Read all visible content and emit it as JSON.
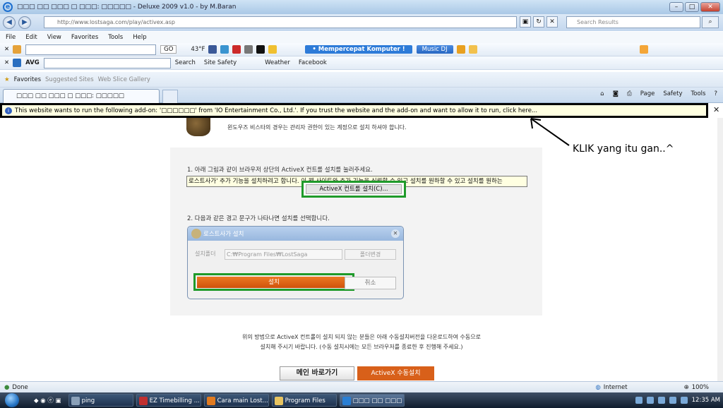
{
  "window": {
    "title": "□□□ □□ □□□ □ □□□: □□□□□ - Deluxe 2009 v1.0 - by M.Baran"
  },
  "address": {
    "url": "http://www.lostsaga.com/play/activex.asp",
    "search_placeholder": "Search Results"
  },
  "menu": [
    "File",
    "Edit",
    "View",
    "Favorites",
    "Tools",
    "Help"
  ],
  "toolbar1": {
    "go": "GO",
    "weather_temp": "43°F",
    "promo": "• Mempercepat Komputer !",
    "music": "Music DJ"
  },
  "toolbar2": {
    "avg": "AVG",
    "search": "Search",
    "site_safety": "Site Safety",
    "weather": "Weather",
    "facebook": "Facebook"
  },
  "favbar": {
    "favorites": "Favorites",
    "suggested": "Suggested Sites",
    "webslice": "Web Slice Gallery"
  },
  "tab": {
    "title": "□□□ □□ □□□ □ □□□: □□□□□"
  },
  "commands": [
    "Page",
    "Safety",
    "Tools"
  ],
  "infobar": {
    "text": "This website wants to run the following add-on: '□□□□□□' from 'IO Entertainment Co., Ltd.'. If you trust the website and the add-on and want to allow it to run, click here..."
  },
  "content": {
    "line0": "윈도우즈 비스타의 경우는 관리자 권한이 있는 계정으로 설치 하셔야 합니다.",
    "step1": "1. 아래 그림과 같이 브라우저 상단의 ActiveX 컨트롤 설치를 눌러주세요.",
    "korean_bar": "로스트사가' 추가 기능을 설치하려고 합니다. 이 웹 사이트와 추가 기능을 신뢰할 수 있고 설치를 원하할 수 있고 설치를 원하는",
    "activex_btn": "ActiveX 컨트롤 설치(C)...",
    "step2": "2. 다음과 같은 경고 문구가 나타나면 설치를 선택합니다.",
    "dialog_title": "로스트사가 설치",
    "folder_label": "설치폴더",
    "folder_path": "C:₩Program Files₩LostSaga",
    "folder_change": "폴더변경",
    "install": "설치",
    "cancel": "취소",
    "note1": "위의 방법으로 ActiveX 컨트롤이 설치 되지 않는 분들은 아래 수동설치버전을 다운로드하여 수동으로",
    "note2": "설치해 주시기 바랍니다. (수동 설치시에는 모든 브라우저를 종료한 후 진행해 주세요.)",
    "main_btn": "메인 바로가기",
    "manual_btn": "ActiveX 수동설치"
  },
  "annotation": "KLIK yang itu gan..^",
  "status": {
    "left": "Done",
    "zone": "Internet",
    "zoom": "100%"
  },
  "taskbar": {
    "items": [
      "ping",
      "EZ Timebilling ...",
      "Cara main Lost...",
      "Program Files",
      "□□□ □□ □□□ □ ..."
    ],
    "time": "12:35 AM"
  },
  "colors": {
    "highlight_green": "#1f9a2a",
    "install_orange": "#d8601a",
    "infobar_yellow": "#ffffe1"
  }
}
